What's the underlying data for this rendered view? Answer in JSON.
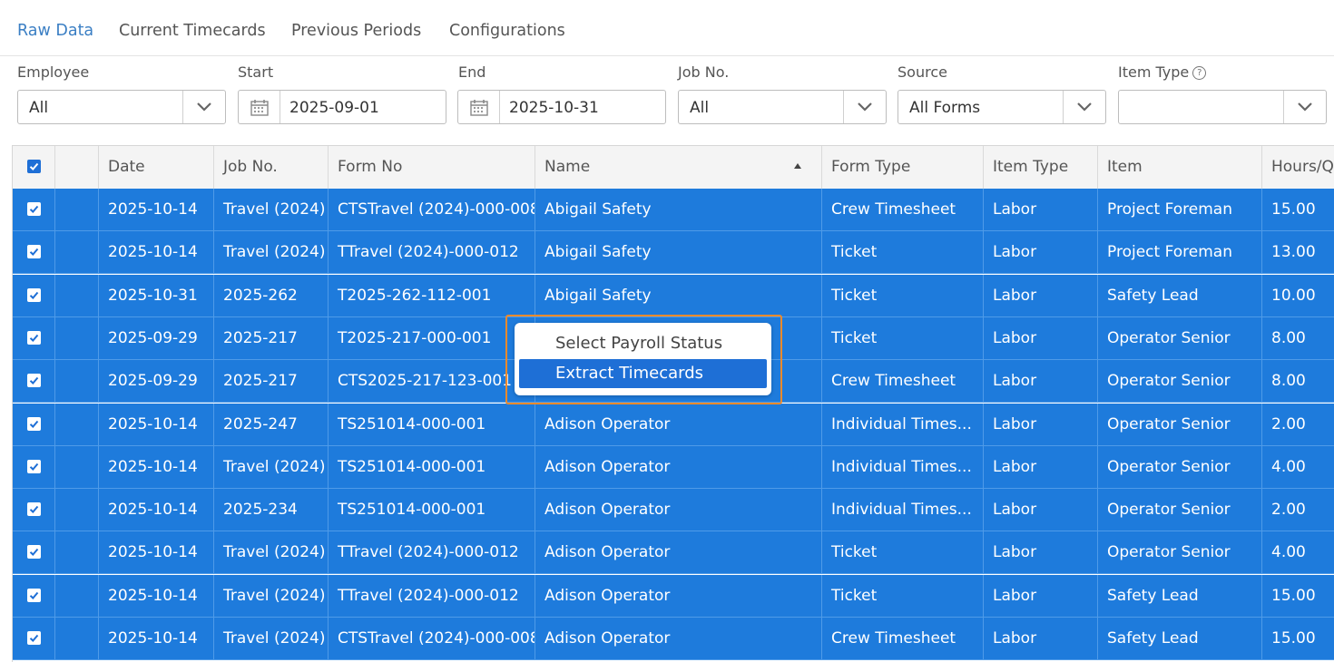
{
  "tabs": [
    "Raw Data",
    "Current Timecards",
    "Previous Periods",
    "Configurations"
  ],
  "filters": {
    "employee": {
      "label": "Employee",
      "value": "All"
    },
    "start": {
      "label": "Start",
      "value": "2025-09-01"
    },
    "end": {
      "label": "End",
      "value": "2025-10-31"
    },
    "job_no": {
      "label": "Job No.",
      "value": "All"
    },
    "source": {
      "label": "Source",
      "value": "All Forms"
    },
    "item_type": {
      "label": "Item Type",
      "value": ""
    }
  },
  "grid": {
    "columns": [
      "Date",
      "Job No.",
      "Form No",
      "Name",
      "Form Type",
      "Item Type",
      "Item",
      "Hours/Q"
    ],
    "sorted_column": "Name",
    "rows": [
      [
        "2025-10-14",
        "Travel (2024)",
        "CTSTravel (2024)-000-008",
        "Abigail Safety",
        "Crew Timesheet",
        "Labor",
        "Project Foreman",
        "15.00"
      ],
      [
        "2025-10-14",
        "Travel (2024)",
        "TTravel (2024)-000-012",
        "Abigail Safety",
        "Ticket",
        "Labor",
        "Project Foreman",
        "13.00"
      ],
      [
        "2025-10-31",
        "2025-262",
        "T2025-262-112-001",
        "Abigail Safety",
        "Ticket",
        "Labor",
        "Safety Lead",
        "10.00"
      ],
      [
        "2025-09-29",
        "2025-217",
        "T2025-217-000-001",
        "",
        "Ticket",
        "Labor",
        "Operator Senior",
        "8.00"
      ],
      [
        "2025-09-29",
        "2025-217",
        "CTS2025-217-123-001",
        "",
        "Crew Timesheet",
        "Labor",
        "Operator Senior",
        "8.00"
      ],
      [
        "2025-10-14",
        "2025-247",
        "TS251014-000-001",
        "Adison Operator",
        "Individual Times...",
        "Labor",
        "Operator Senior",
        "2.00"
      ],
      [
        "2025-10-14",
        "Travel (2024)",
        "TS251014-000-001",
        "Adison Operator",
        "Individual Times...",
        "Labor",
        "Operator Senior",
        "4.00"
      ],
      [
        "2025-10-14",
        "2025-234",
        "TS251014-000-001",
        "Adison Operator",
        "Individual Times...",
        "Labor",
        "Operator Senior",
        "2.00"
      ],
      [
        "2025-10-14",
        "Travel (2024)",
        "TTravel (2024)-000-012",
        "Adison Operator",
        "Ticket",
        "Labor",
        "Operator Senior",
        "4.00"
      ],
      [
        "2025-10-14",
        "Travel (2024)",
        "TTravel (2024)-000-012",
        "Adison Operator",
        "Ticket",
        "Labor",
        "Safety Lead",
        "15.00"
      ],
      [
        "2025-10-14",
        "Travel (2024)",
        "CTSTravel (2024)-000-008",
        "Adison Operator",
        "Crew Timesheet",
        "Labor",
        "Safety Lead",
        "15.00"
      ]
    ]
  },
  "context_menu": {
    "items": [
      "Select Payroll Status",
      "Extract Timecards"
    ],
    "highlighted": "Extract Timecards"
  },
  "colors": {
    "accent": "#3b7fc4",
    "row_selected": "#1e7bdc",
    "menu_highlight": "#1e6fd6",
    "menu_outline": "#ef8a2c"
  }
}
